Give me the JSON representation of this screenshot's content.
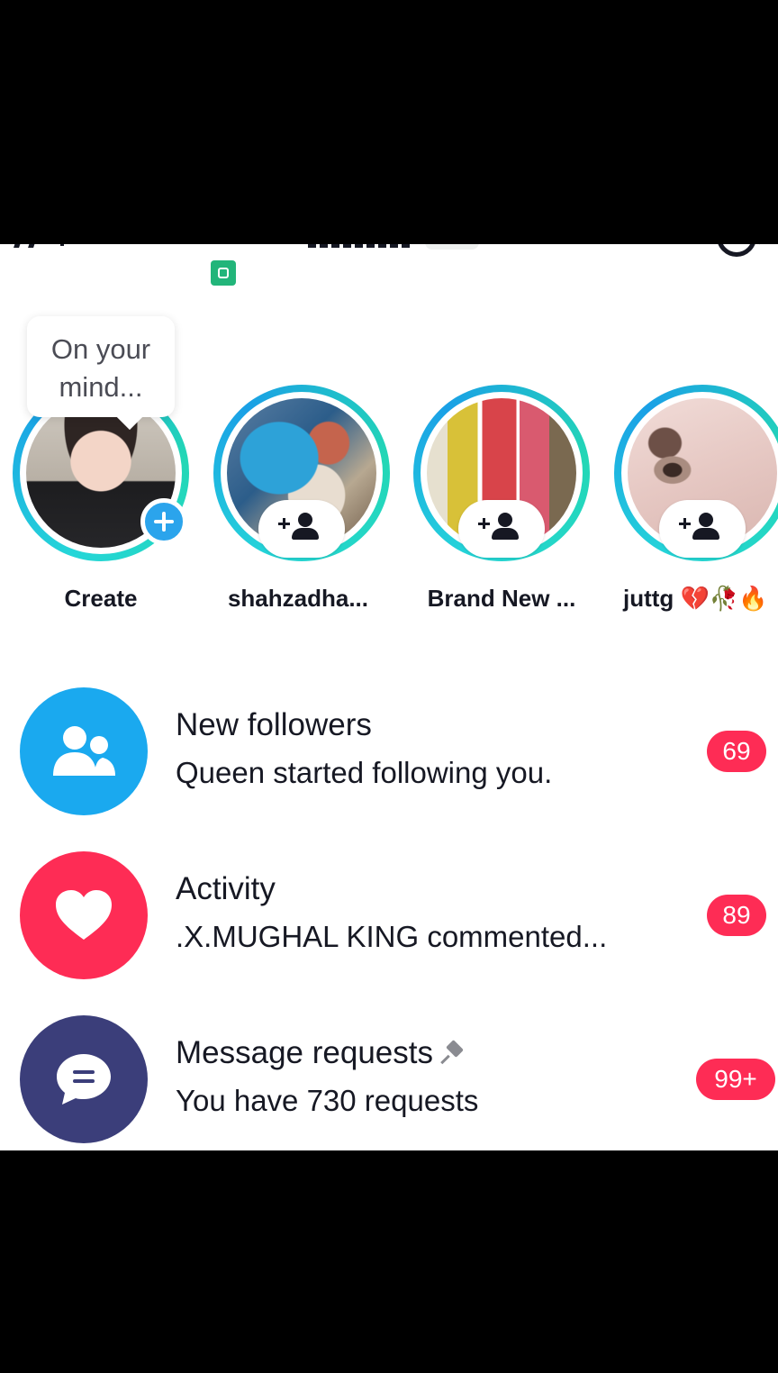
{
  "colors": {
    "followers_icon_bg": "#1aa9ef",
    "activity_icon_bg": "#fe2c55",
    "requests_icon_bg": "#3b3e7a",
    "badge_bg": "#fe2c55",
    "story_ring": "#25d6d8"
  },
  "stories": [
    {
      "label": "Create",
      "icon": "add-plus-icon"
    },
    {
      "label": "shahzadha...",
      "icon": "follow-user-icon"
    },
    {
      "label": "Brand New ...",
      "icon": "follow-user-icon"
    },
    {
      "label": "juttg 💔🥀🔥",
      "icon": "follow-user-icon"
    }
  ],
  "bubble": {
    "text_line1": "On your",
    "text_line2": "mind..."
  },
  "rows": [
    {
      "title": "New followers",
      "subtitle": "Queen started following you.",
      "badge": "69",
      "icon": "followers-icon"
    },
    {
      "title": "Activity",
      "subtitle": ".X.MUGHAL KING commented...",
      "badge": "89",
      "icon": "heart-icon"
    },
    {
      "title": "Message requests",
      "subtitle": "You have 730 requests",
      "badge": "99+",
      "icon": "message-icon"
    }
  ]
}
